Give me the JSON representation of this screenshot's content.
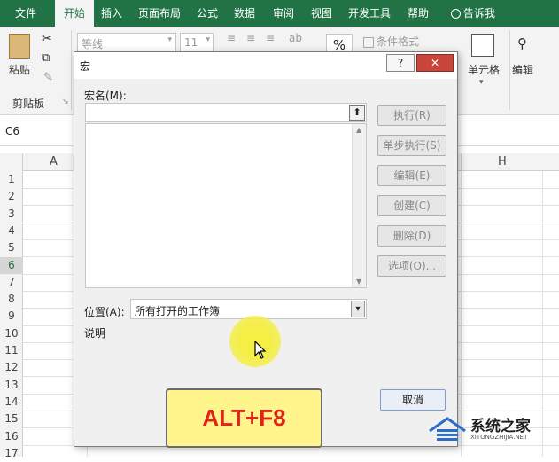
{
  "tabs": [
    {
      "label": "文件"
    },
    {
      "label": "开始"
    },
    {
      "label": "插入"
    },
    {
      "label": "页面布局"
    },
    {
      "label": "公式"
    },
    {
      "label": "数据"
    },
    {
      "label": "审阅"
    },
    {
      "label": "视图"
    },
    {
      "label": "开发工具"
    },
    {
      "label": "帮助"
    },
    {
      "label": "告诉我"
    }
  ],
  "ribbon": {
    "paste_label": "粘贴",
    "clipboard_label": "剪贴板",
    "font_name": "等线",
    "font_size": "11",
    "percent": "%",
    "conditional_format": "条件格式",
    "cells_label": "单元格",
    "edit_label": "编辑"
  },
  "namebox": "C6",
  "columns": [
    "A",
    "H"
  ],
  "rows": [
    "1",
    "2",
    "3",
    "4",
    "5",
    "6",
    "7",
    "8",
    "9",
    "10",
    "11",
    "12",
    "13",
    "14",
    "15",
    "16",
    "17"
  ],
  "dialog": {
    "title": "宏",
    "help_btn": "?",
    "close_btn": "✕",
    "macro_name_label": "宏名(M):",
    "macro_name_value": "",
    "buttons": [
      "执行(R)",
      "单步执行(S)",
      "编辑(E)",
      "创建(C)",
      "删除(D)",
      "选项(O)..."
    ],
    "location_label": "位置(A):",
    "location_value": "所有打开的工作簿",
    "description_label": "说明",
    "cancel": "取消"
  },
  "overlay_badge": "ALT+F8",
  "watermark": {
    "cn": "系统之家",
    "url": "XITONGZHIJIA.NET"
  },
  "colors": {
    "excel_green": "#217346",
    "badge_bg": "#fff58c",
    "badge_text": "#e2231a"
  }
}
